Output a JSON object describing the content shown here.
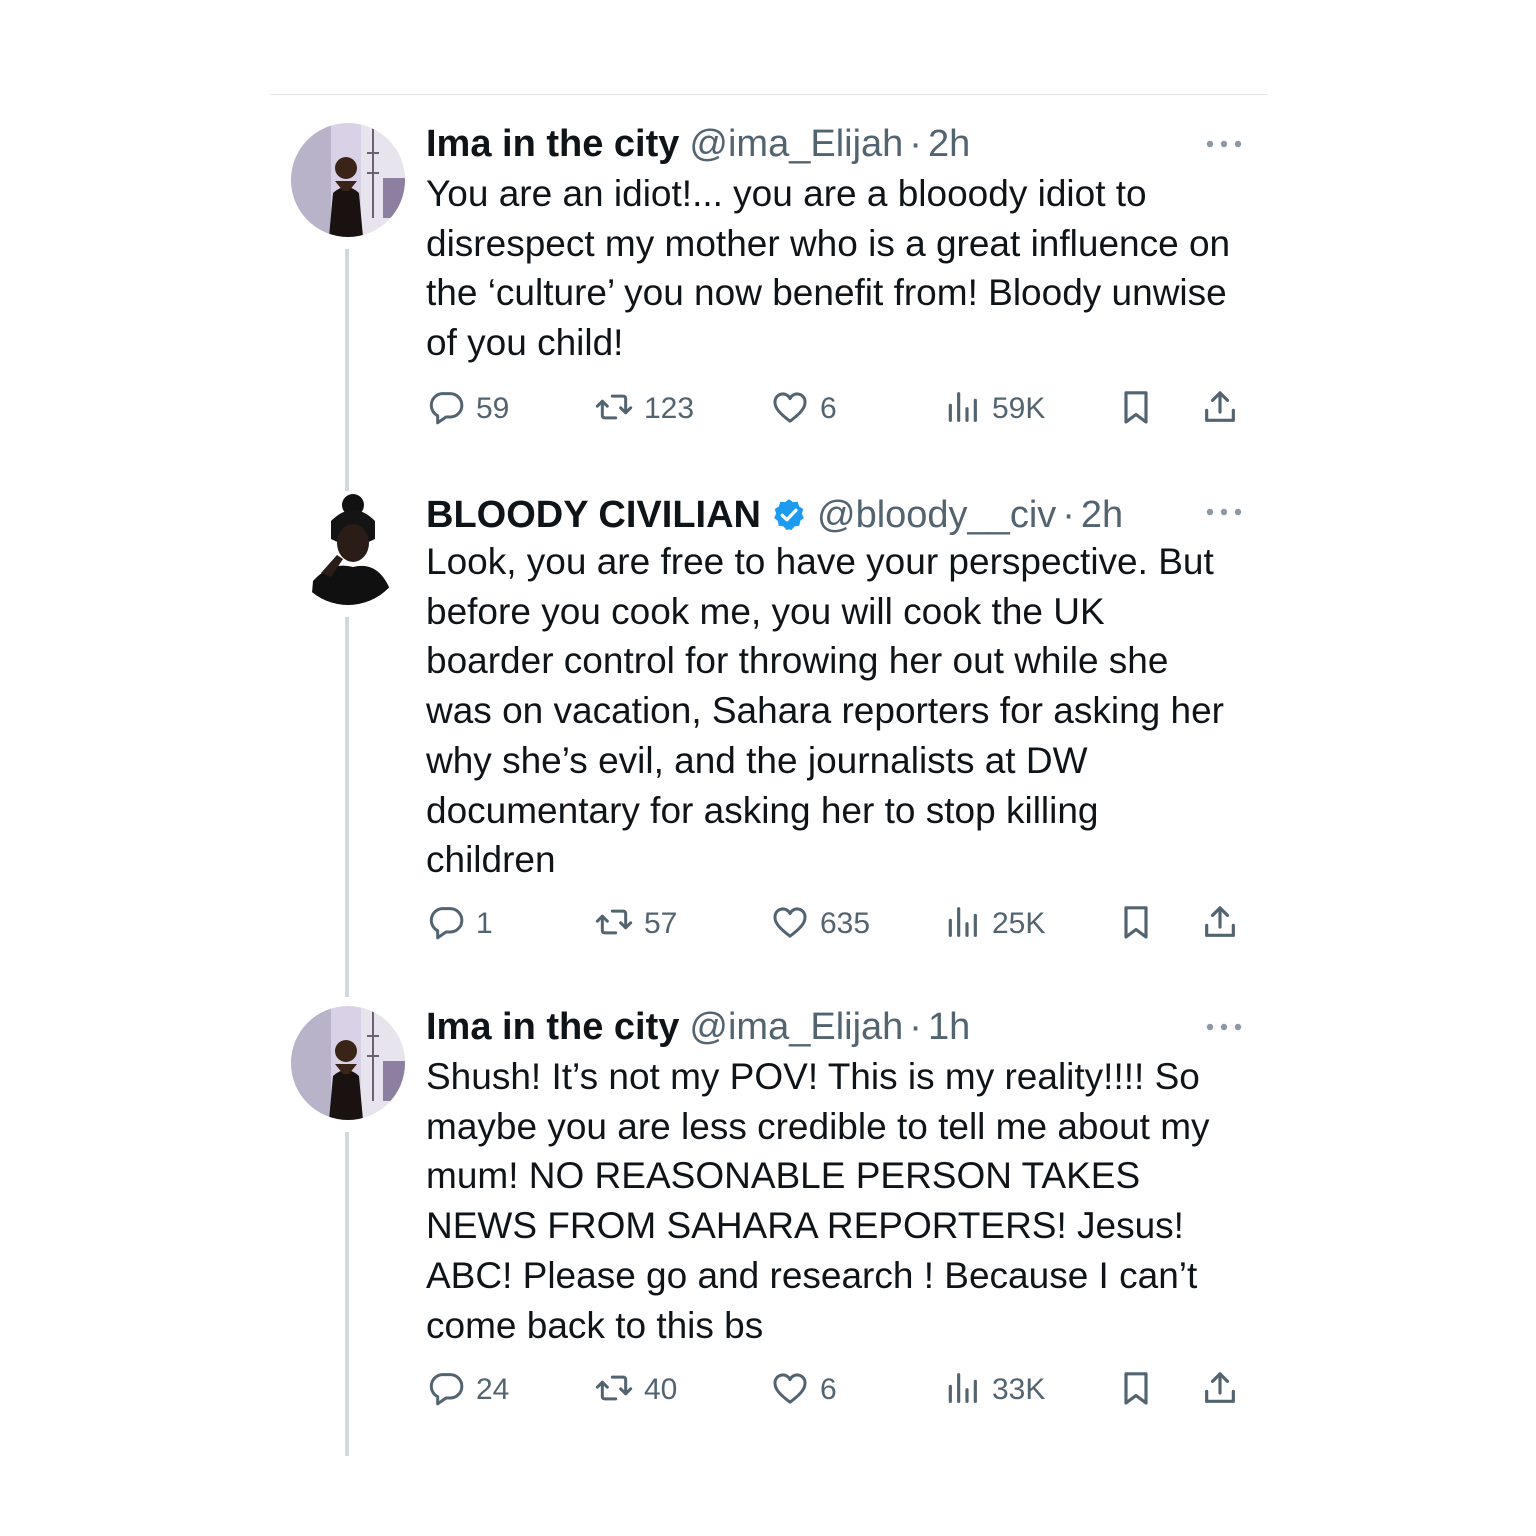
{
  "tweets": [
    {
      "name": "Ima in the city",
      "handle": "@ima_Elijah",
      "time": "2h",
      "verified": false,
      "text": "You are an idiot!... you are a blooody idiot to disrespect my mother who is a great influence on the ‘culture’ you now benefit from! Bloody unwise of you child!",
      "replies": "59",
      "reposts": "123",
      "likes": "6",
      "views": "59K"
    },
    {
      "name": "BLOODY CIVILIAN",
      "handle": "@bloody__civ",
      "time": "2h",
      "verified": true,
      "text": "Look, you are free to have your perspective. But before you cook me, you will cook the UK boarder control for throwing her out while she was on vacation, Sahara reporters for asking her why she’s evil, and the journalists at DW documentary for asking her to stop killing children",
      "replies": "1",
      "reposts": "57",
      "likes": "635",
      "views": "25K"
    },
    {
      "name": "Ima in the city",
      "handle": "@ima_Elijah",
      "time": "1h",
      "verified": false,
      "text": "Shush! It’s not my POV! This is my reality!!!! So maybe you are less credible to tell me about my mum! NO REASONABLE PERSON TAKES NEWS FROM SAHARA REPORTERS! Jesus! ABC! Please go and research ! Because I can’t come back to this bs",
      "replies": "24",
      "reposts": "40",
      "likes": "6",
      "views": "33K"
    }
  ],
  "icons": {
    "reply": "reply-icon",
    "repost": "repost-icon",
    "like": "like-icon",
    "views": "views-icon",
    "bookmark": "bookmark-icon",
    "share": "share-icon",
    "more": "more-icon",
    "verified": "verified-badge-icon"
  },
  "colors": {
    "text": "#0f1419",
    "secondary": "#536471",
    "verified": "#1d9bf0",
    "thread_line": "#cfd9de"
  }
}
